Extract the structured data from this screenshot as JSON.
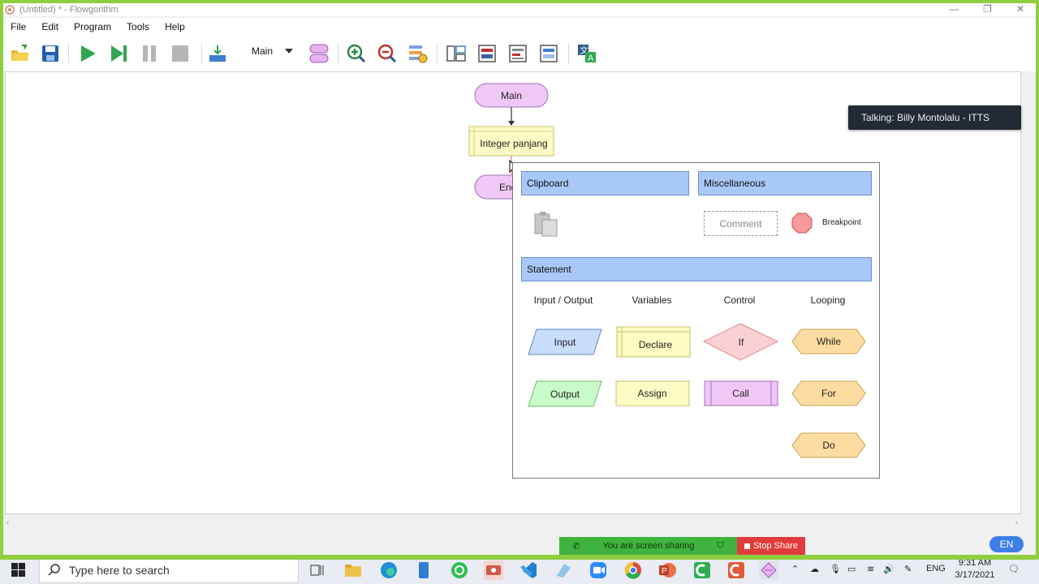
{
  "window": {
    "title": "(Untitled) * - Flowgorithm",
    "minimize": "—",
    "restore": "❐",
    "close": "✕"
  },
  "menu": [
    "File",
    "Edit",
    "Program",
    "Tools",
    "Help"
  ],
  "toolbar": {
    "function_select": "Main"
  },
  "flowchart": {
    "start_label": "Main",
    "declare_label": "Integer panjang",
    "end_label": "End"
  },
  "popup": {
    "clipboard": "Clipboard",
    "miscellaneous": "Miscellaneous",
    "comment": "Comment",
    "breakpoint": "Breakpoint",
    "statement": "Statement",
    "columns": {
      "io": "Input / Output",
      "variables": "Variables",
      "control": "Control",
      "looping": "Looping"
    },
    "shapes": {
      "input": "Input",
      "output": "Output",
      "declare": "Declare",
      "assign": "Assign",
      "if": "If",
      "call": "Call",
      "while": "While",
      "for": "For",
      "do": "Do"
    }
  },
  "colors": {
    "terminal": "#f0c8f8",
    "declare": "#fdfcc4",
    "input": "#c8dcfc",
    "output": "#c8fcc8",
    "if": "#fbd0d4",
    "call": "#f0c8f8",
    "loop": "#fcdca0",
    "section": "#a8c8f8",
    "breakpoint": "#f49a9a"
  },
  "talking": "Talking: Billy Montolalu - ITTS",
  "screen_share": {
    "message": "You are screen sharing",
    "stop": "Stop Share"
  },
  "language_badge": "EN",
  "taskbar": {
    "search_placeholder": "Type here to search",
    "lang": "ENG",
    "time": "9:31 AM",
    "date": "3/17/2021"
  }
}
